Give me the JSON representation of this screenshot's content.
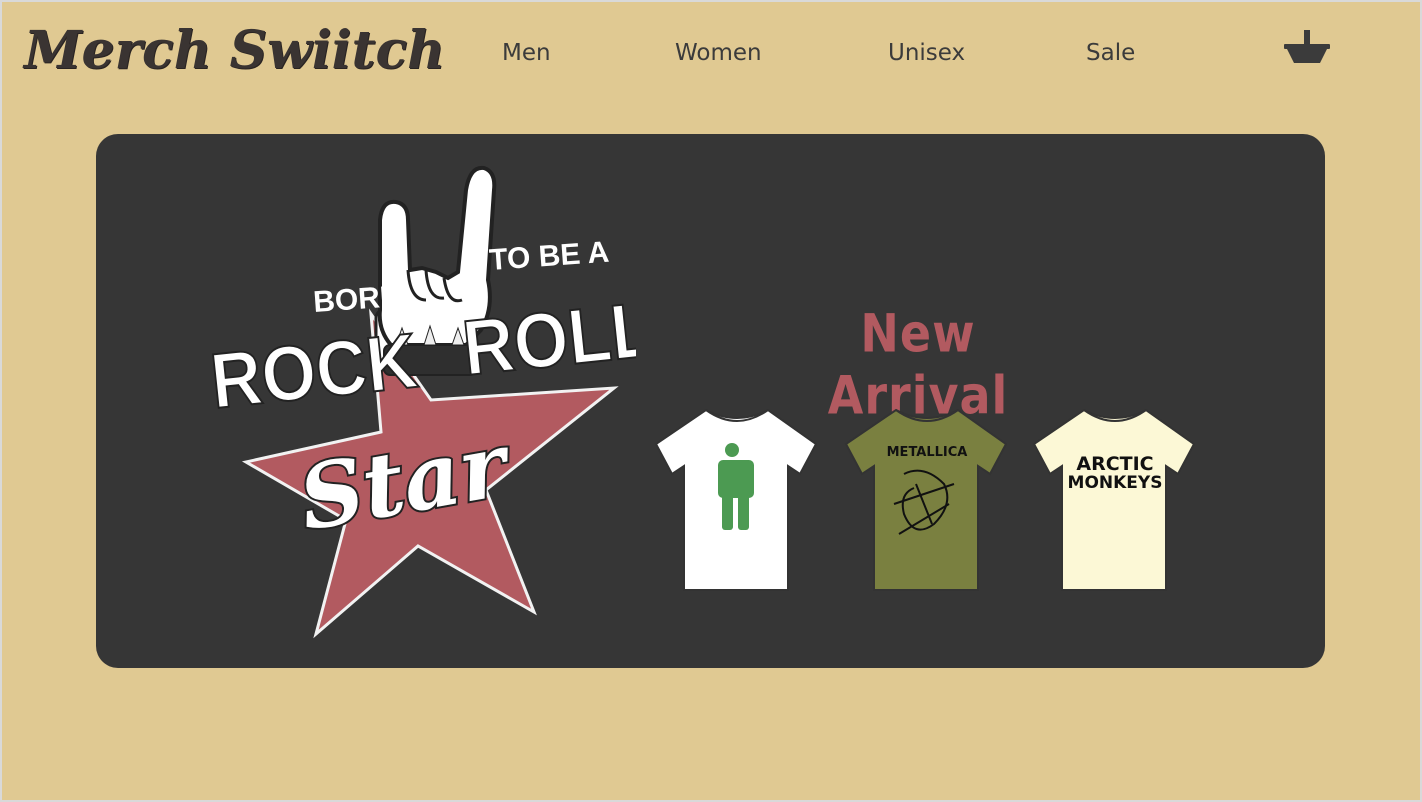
{
  "brand": {
    "name": "Merch Swiitch"
  },
  "nav": {
    "items": [
      {
        "label": "Men"
      },
      {
        "label": "Women"
      },
      {
        "label": "Unisex"
      },
      {
        "label": "Sale"
      }
    ],
    "cart_icon": "basket-icon"
  },
  "hero": {
    "poster": {
      "born": "BORN",
      "to_be_a": "TO BE A",
      "rock": "ROCK",
      "roll": "ROLL",
      "star": "Star",
      "icon": "rock-hand-icon"
    },
    "headline": "New Arrival",
    "products": [
      {
        "name": "billie-eilish-shirt",
        "print": "",
        "color": "#ffffff",
        "print_color": "#4c9a52"
      },
      {
        "name": "metallica-shirt",
        "print": "METALLICA",
        "color": "#7a8040",
        "print_color": "#111111"
      },
      {
        "name": "arctic-monkeys-shirt",
        "print_lines": [
          "ARCTIC",
          "MONKEYS"
        ],
        "color": "#fcf8d6",
        "print_color": "#111111"
      }
    ]
  },
  "colors": {
    "background": "#e0c992",
    "panel": "#363636",
    "accent": "#b25a60",
    "text": "#3b3b3b"
  }
}
